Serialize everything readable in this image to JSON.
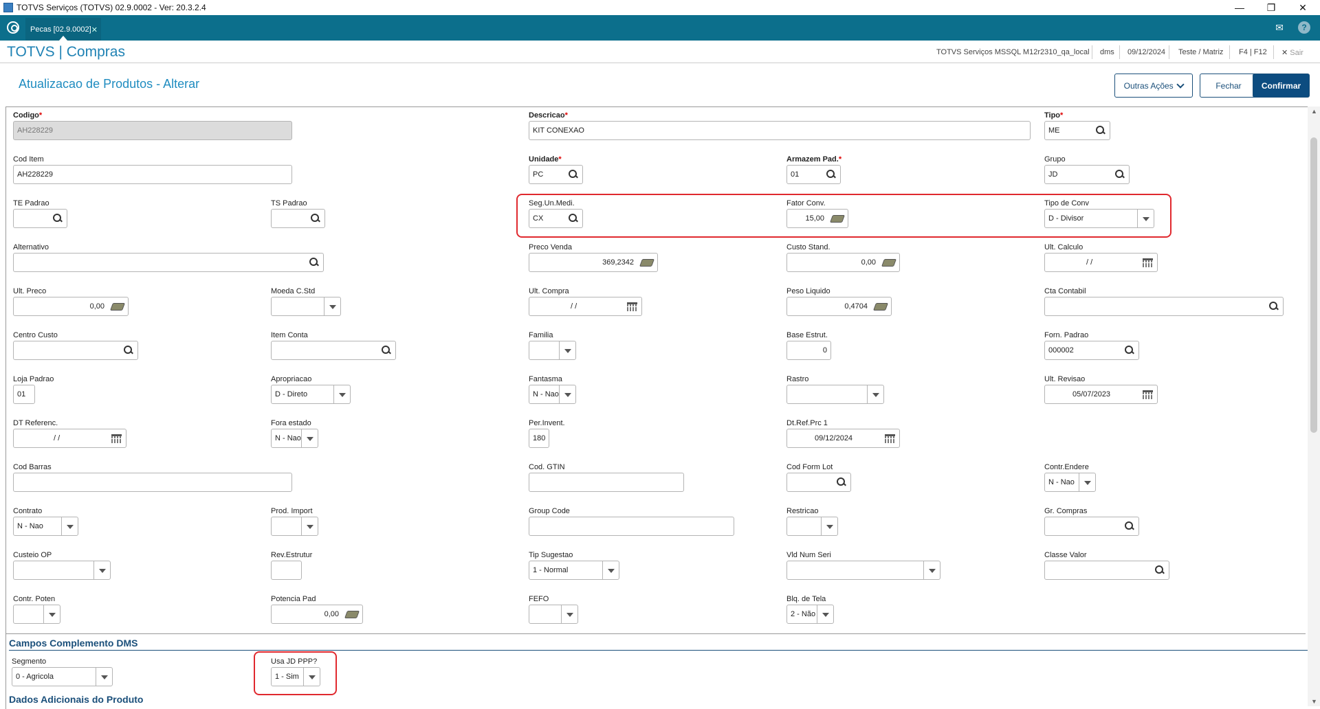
{
  "window": {
    "title": "TOTVS Serviços (TOTVS) 02.9.0002 - Ver: 20.3.2.4"
  },
  "tabs": [
    {
      "label": "Pecas [02.9.0002]"
    }
  ],
  "header": {
    "brand": "TOTVS | Compras",
    "environment": "TOTVS Serviços MSSQL M12r2310_qa_local",
    "user": "dms",
    "date": "09/12/2024",
    "company": "Teste / Matriz",
    "shortcuts": "F4 | F12",
    "exit_label": "Sair"
  },
  "page": {
    "title": "Atualizacao de Produtos - Alterar",
    "buttons": {
      "other_actions": "Outras Ações",
      "close": "Fechar",
      "confirm": "Confirmar"
    }
  },
  "fields": {
    "codigo": {
      "label": "Codigo",
      "required": "*",
      "value": "AH228229"
    },
    "descricao": {
      "label": "Descricao",
      "required": "*",
      "value": "KIT CONEXAO"
    },
    "tipo": {
      "label": "Tipo",
      "required": "*",
      "value": "ME"
    },
    "cod_item": {
      "label": "Cod Item",
      "value": "AH228229"
    },
    "unidade": {
      "label": "Unidade",
      "required": "*",
      "value": "PC"
    },
    "armazem": {
      "label": "Armazem Pad.",
      "required": "*",
      "value": "01"
    },
    "grupo": {
      "label": "Grupo",
      "value": "JD"
    },
    "te_padrao": {
      "label": "TE Padrao",
      "value": ""
    },
    "ts_padrao": {
      "label": "TS Padrao",
      "value": ""
    },
    "seg_un": {
      "label": "Seg.Un.Medi.",
      "value": "CX"
    },
    "fator_conv": {
      "label": "Fator Conv.",
      "value": "15,00"
    },
    "tipo_conv": {
      "label": "Tipo de Conv",
      "value": "D - Divisor"
    },
    "alternativo": {
      "label": "Alternativo",
      "value": ""
    },
    "preco_venda": {
      "label": "Preco Venda",
      "value": "369,2342"
    },
    "custo_stand": {
      "label": "Custo Stand.",
      "value": "0,00"
    },
    "ult_calculo": {
      "label": "Ult. Calculo",
      "value": "/ /"
    },
    "ult_preco": {
      "label": "Ult. Preco",
      "value": "0,00"
    },
    "moeda": {
      "label": "Moeda C.Std",
      "value": ""
    },
    "ult_compra": {
      "label": "Ult. Compra",
      "value": "/ /"
    },
    "peso_liquido": {
      "label": "Peso Liquido",
      "value": "0,4704"
    },
    "cta_contabil": {
      "label": "Cta Contabil",
      "value": ""
    },
    "centro_custo": {
      "label": "Centro Custo",
      "value": ""
    },
    "item_conta": {
      "label": "Item Conta",
      "value": ""
    },
    "familia": {
      "label": "Familia",
      "value": ""
    },
    "base_estrut": {
      "label": "Base Estrut.",
      "value": "0"
    },
    "forn_padrao": {
      "label": "Forn. Padrao",
      "value": "000002"
    },
    "loja_padrao": {
      "label": "Loja Padrao",
      "value": "01"
    },
    "apropriacao": {
      "label": "Apropriacao",
      "value": "D - Direto"
    },
    "fantasma": {
      "label": "Fantasma",
      "value": "N - Nao"
    },
    "rastro": {
      "label": "Rastro",
      "value": ""
    },
    "ult_revisao": {
      "label": "Ult. Revisao",
      "value": "05/07/2023"
    },
    "dt_referenc": {
      "label": "DT Referenc.",
      "value": "/ /"
    },
    "fora_estado": {
      "label": "Fora estado",
      "value": "N - Nao"
    },
    "per_invent": {
      "label": "Per.Invent.",
      "value": "180"
    },
    "dt_ref_prc": {
      "label": "Dt.Ref.Prc 1",
      "value": "09/12/2024"
    },
    "cod_barras": {
      "label": "Cod Barras",
      "value": ""
    },
    "cod_gtin": {
      "label": "Cod. GTIN",
      "value": ""
    },
    "cod_form_lot": {
      "label": "Cod Form Lot",
      "value": ""
    },
    "contr_endere": {
      "label": "Contr.Endere",
      "value": "N - Nao"
    },
    "contrato": {
      "label": "Contrato",
      "value": "N - Nao"
    },
    "prod_import": {
      "label": "Prod. Import",
      "value": ""
    },
    "group_code": {
      "label": "Group Code",
      "value": ""
    },
    "restricao": {
      "label": "Restricao",
      "value": ""
    },
    "gr_compras": {
      "label": "Gr. Compras",
      "value": ""
    },
    "custeio_op": {
      "label": "Custeio OP",
      "value": ""
    },
    "rev_estrutur": {
      "label": "Rev.Estrutur",
      "value": ""
    },
    "tip_sugestao": {
      "label": "Tip Sugestao",
      "value": "1 - Normal"
    },
    "vld_num_seri": {
      "label": "Vld Num Seri",
      "value": ""
    },
    "classe_valor": {
      "label": "Classe Valor",
      "value": ""
    },
    "contr_poten": {
      "label": "Contr. Poten",
      "value": ""
    },
    "potencia_pad": {
      "label": "Potencia Pad",
      "value": "0,00"
    },
    "fefo": {
      "label": "FEFO",
      "value": ""
    },
    "blq_tela": {
      "label": "Blq. de Tela",
      "value": "2 - Não"
    }
  },
  "dms": {
    "section_title": "Campos Complemento DMS",
    "segmento": {
      "label": "Segmento",
      "value": "0 - Agricola"
    },
    "usa_jd_ppp": {
      "label": "Usa JD PPP?",
      "value": "1 - Sim"
    }
  },
  "extra_section_title": "Dados Adicionais do Produto",
  "colors": {
    "accent": "#0c6f8c",
    "brand": "#1f82b4",
    "highlight": "#e0282e",
    "primary_button": "#0c4c80"
  }
}
